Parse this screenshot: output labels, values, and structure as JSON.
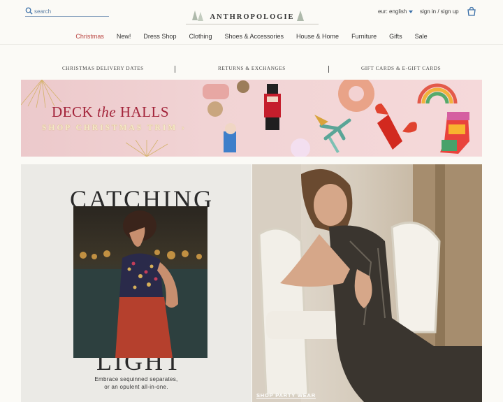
{
  "header": {
    "search_placeholder": "search",
    "logo": "ANTHROPOLOGIE",
    "locale": "eur: english",
    "sign_in": "sign in / sign up"
  },
  "nav": {
    "items": [
      {
        "label": "Christmas",
        "active": true
      },
      {
        "label": "New!"
      },
      {
        "label": "Dress Shop"
      },
      {
        "label": "Clothing"
      },
      {
        "label": "Shoes & Accessories"
      },
      {
        "label": "House & Home"
      },
      {
        "label": "Furniture"
      },
      {
        "label": "Gifts"
      },
      {
        "label": "Sale"
      }
    ]
  },
  "utility": {
    "links": [
      "CHRISTMAS DELIVERY DATES",
      "RETURNS & EXCHANGES",
      "GIFT CARDS & E-GIFT CARDS"
    ]
  },
  "banner": {
    "deck_pre": "DECK ",
    "deck_the": "the",
    "deck_post": " HALLS",
    "cta": "SHOP CHRISTMAS TRIM ›"
  },
  "promo_left": {
    "headline_top": "CATCHING",
    "headline_bottom": "LIGHT",
    "tagline_1": "Embrace sequinned separates,",
    "tagline_2": "or an opulent all-in-one."
  },
  "promo_right": {
    "cta": "SHOP PARTY WEAR"
  },
  "colors": {
    "accent_red": "#b9433f",
    "link_blue": "#3a6fa8",
    "banner_red": "#a3243a"
  }
}
